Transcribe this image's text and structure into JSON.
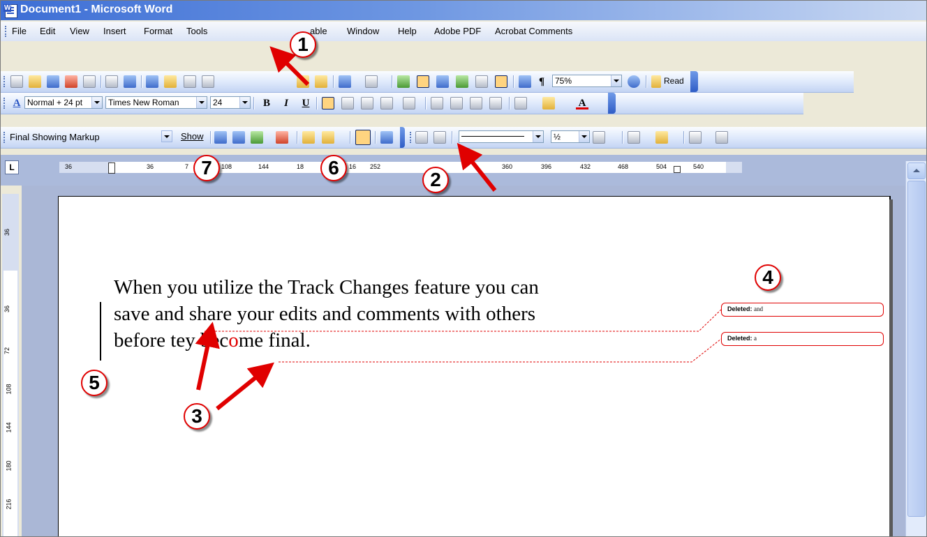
{
  "window": {
    "title": "Document1 - Microsoft Word"
  },
  "menu": {
    "items": [
      {
        "label": "File"
      },
      {
        "label": "Edit"
      },
      {
        "label": "View"
      },
      {
        "label": "Insert"
      },
      {
        "label": "Format"
      },
      {
        "label": "Tools"
      },
      {
        "label": "able"
      },
      {
        "label": "Window"
      },
      {
        "label": "Help"
      },
      {
        "label": "Adobe PDF"
      },
      {
        "label": "Acrobat Comments"
      }
    ]
  },
  "standard_toolbar": {
    "zoom": "75%",
    "read_label": "Read",
    "pilcrow": "¶"
  },
  "formatting_toolbar": {
    "style": "Normal + 24 pt",
    "font": "Times New Roman",
    "size": "24",
    "bold": "B",
    "italic": "I",
    "underline": "U",
    "font_color_glyph": "A",
    "style_glyph": "A"
  },
  "reviewing_toolbar": {
    "display_mode": "Final Showing Markup",
    "show_label": "Show",
    "line_weight": "½"
  },
  "ruler": {
    "corner": "L",
    "ticks": [
      "36",
      "36",
      "7",
      "108",
      "144",
      "18",
      "16",
      "252",
      "360",
      "396",
      "432",
      "468",
      "504",
      "540"
    ],
    "vticks": [
      "36",
      "36",
      "72",
      "108",
      "144",
      "180",
      "216"
    ]
  },
  "document": {
    "line1": "When you utilize the Track Changes feature you can",
    "line2": "save and share your edits and comments with others",
    "line3_before": "before t",
    "line3_middle": "ey bec",
    "line3_deleted": "o",
    "line3_after": "me final."
  },
  "balloons": [
    {
      "label": "Deleted:",
      "text": "and"
    },
    {
      "label": "Deleted:",
      "text": "a"
    }
  ],
  "callouts": [
    "1",
    "2",
    "3",
    "4",
    "5",
    "6",
    "7"
  ],
  "colors": {
    "callout_border": "#e00000",
    "arrow": "#e00000",
    "title_bar": "#3d6ed5"
  }
}
